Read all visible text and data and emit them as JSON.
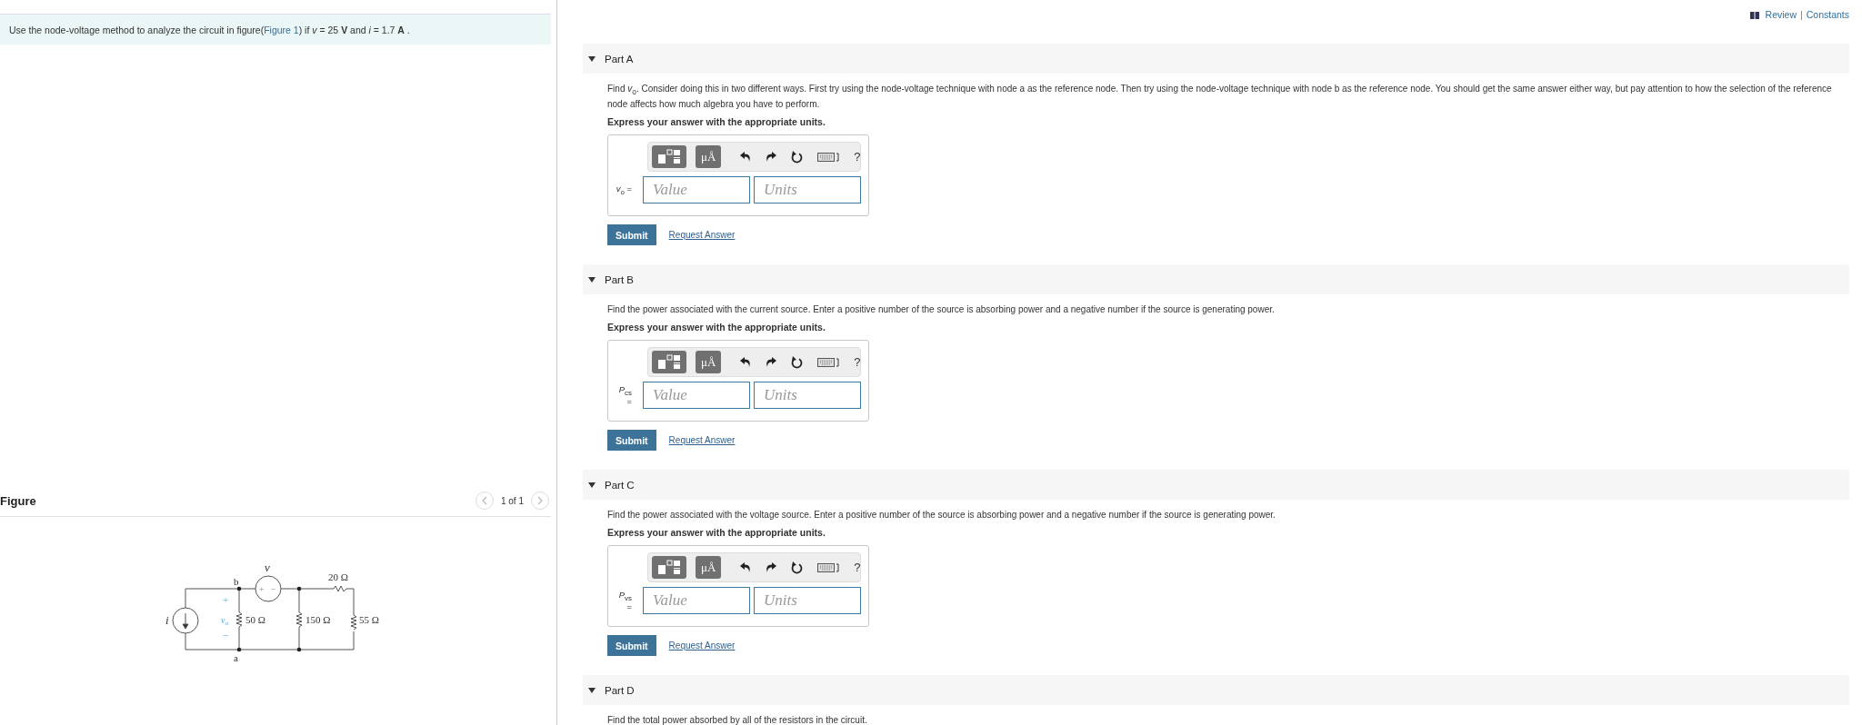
{
  "header_links": {
    "review": "Review",
    "separator": "|",
    "constants": "Constants"
  },
  "problem": {
    "text_before": "Use the node-voltage method to analyze the circuit in figure(",
    "link": "Figure 1",
    "text_after": ") if *v* = 25 **V** and *i* = 1.7 **A** ."
  },
  "figure": {
    "title": "Figure",
    "pager": "1 of 1",
    "circuit": {
      "current": "i",
      "source_voltage": "v",
      "source_polarity": [
        "+",
        "−"
      ],
      "node_top": "b",
      "node_bottom": "a",
      "vo_plus": "+",
      "vo_minus": "−",
      "vo_symbol": "v",
      "vo_subscript": "o",
      "r1": "50 Ω",
      "r2": "150 Ω",
      "r3": "20 Ω",
      "r4": "55 Ω"
    }
  },
  "parts": [
    {
      "label": "Part A",
      "expanded": true,
      "prompt": "Find *v*$_{o}$. Consider doing this in two different ways.  First try using the node-voltage technique with node a as the reference node.  Then try using the node-voltage technique with node b as the reference node.  You should get the same answer either way, but pay attention to how the selection of the reference node affects how much algebra you have to perform.",
      "instruction": "Express your answer with the appropriate units.",
      "answer": {
        "label": "*v*$_{o}$ =",
        "units_button": "μÅ",
        "help": "?",
        "value_placeholder": "Value",
        "units_placeholder": "Units",
        "submit": "Submit",
        "request": "Request Answer"
      }
    },
    {
      "label": "Part B",
      "expanded": true,
      "prompt": "Find the power associated with the current source.  Enter a positive number of the source is absorbing power and a negative number if the source is generating power.",
      "instruction": "Express your answer with the appropriate units.",
      "answer": {
        "label": "*P*$_{cs}$ =",
        "units_button": "μÅ",
        "help": "?",
        "value_placeholder": "Value",
        "units_placeholder": "Units",
        "submit": "Submit",
        "request": "Request Answer"
      }
    },
    {
      "label": "Part C",
      "expanded": true,
      "prompt": "Find the power associated with the voltage source.  Enter a positive number of the source is absorbing power and a negative number if the source is generating power.",
      "instruction": "Express your answer with the appropriate units.",
      "answer": {
        "label": "*P*$_{vs}$ =",
        "units_button": "μÅ",
        "help": "?",
        "value_placeholder": "Value",
        "units_placeholder": "Units",
        "submit": "Submit",
        "request": "Request Answer"
      }
    },
    {
      "label": "Part D",
      "expanded": true,
      "prompt": "Find the total power absorbed by all of the resistors in the circuit."
    }
  ]
}
